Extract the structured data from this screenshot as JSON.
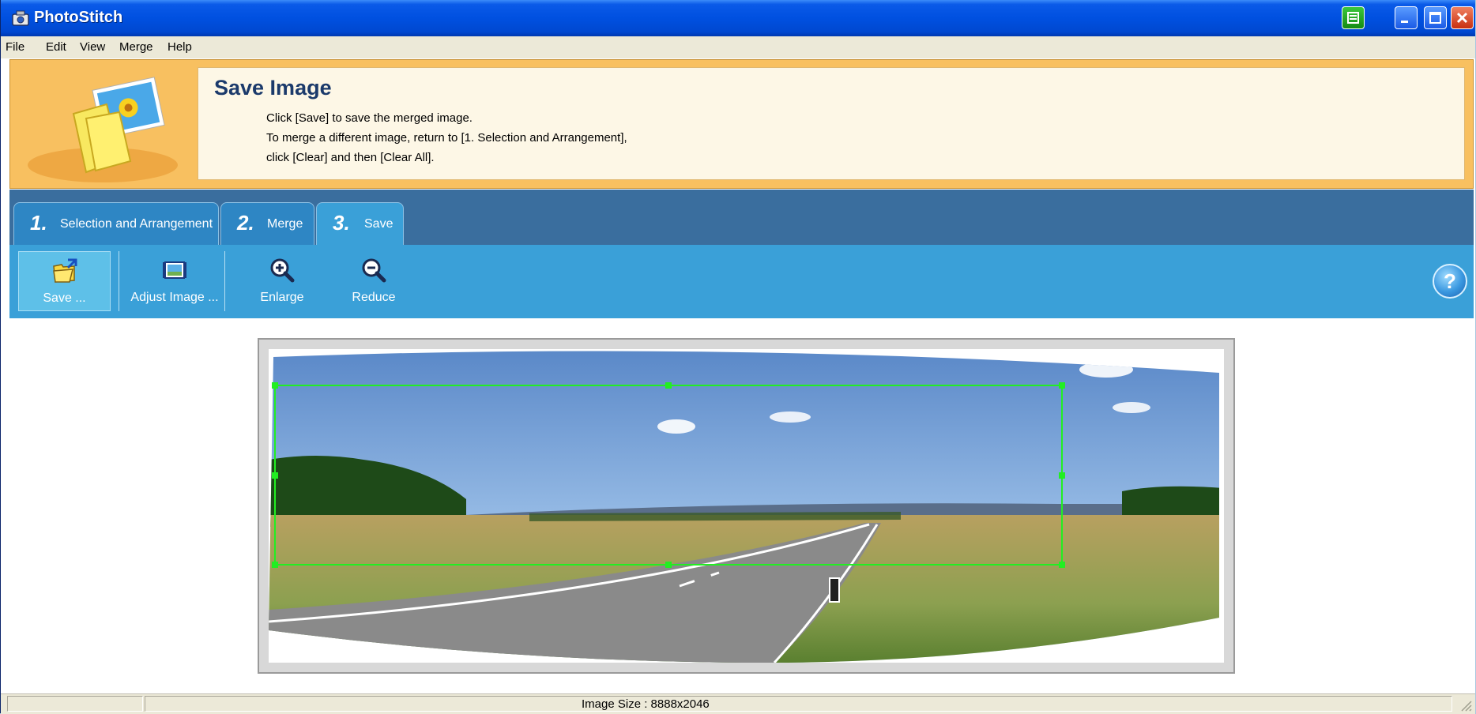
{
  "window": {
    "title": "PhotoStitch"
  },
  "menu": [
    "File",
    "Edit",
    "View",
    "Merge",
    "Help"
  ],
  "header": {
    "title": "Save Image",
    "lines": [
      "Click [Save] to save the merged image.",
      "To merge a different image, return to [1. Selection and Arrangement],",
      "click [Clear] and then [Clear All]."
    ]
  },
  "tabs": [
    {
      "num": "1.",
      "label": "Selection and Arrangement"
    },
    {
      "num": "2.",
      "label": "Merge"
    },
    {
      "num": "3.",
      "label": "Save",
      "active": true
    }
  ],
  "toolbar": [
    {
      "label": "Save ...",
      "icon": "folder-save-icon",
      "active": true
    },
    {
      "label": "Adjust Image ...",
      "icon": "adjust-image-icon"
    },
    {
      "label": "Enlarge",
      "icon": "zoom-in-icon"
    },
    {
      "label": "Reduce",
      "icon": "zoom-out-icon"
    }
  ],
  "help_label": "?",
  "status": {
    "image_size": "Image Size : 8888x2046"
  },
  "colors": {
    "title_bar": "#0050e0",
    "header_bg": "#f8c060",
    "toolbar_bg": "#3aa0d8",
    "crop_rect": "#22ee22"
  }
}
